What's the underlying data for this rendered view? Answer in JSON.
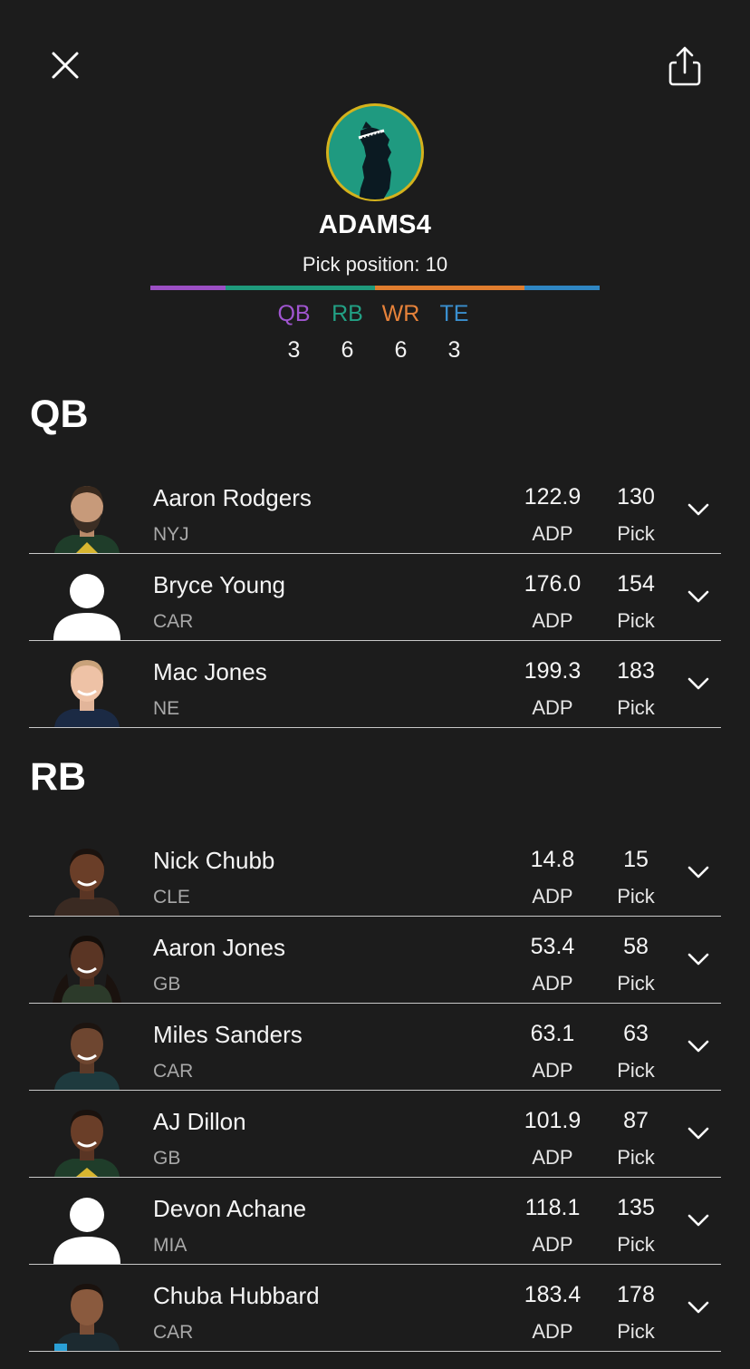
{
  "header": {
    "username": "ADAMS4",
    "pick_position": "Pick position: 10",
    "bar_colors": [
      "#9b4fc4",
      "#1f9a7c",
      "#e07d2e",
      "#2f86c2"
    ],
    "bar_fractions": [
      0.167,
      0.333,
      0.333,
      0.167
    ]
  },
  "counts": [
    {
      "label": "QB",
      "value": "3",
      "color": "#a055d0"
    },
    {
      "label": "RB",
      "value": "6",
      "color": "#22a084"
    },
    {
      "label": "WR",
      "value": "6",
      "color": "#e6823a"
    },
    {
      "label": "TE",
      "value": "3",
      "color": "#3a8fcf"
    }
  ],
  "sections": [
    {
      "title": "QB",
      "players": [
        {
          "name": "Aaron Rodgers",
          "team": "NYJ",
          "adp": "122.9",
          "adp_label": "ADP",
          "pick": "130",
          "pick_label": "Pick",
          "photo": "player-photo"
        },
        {
          "name": "Bryce Young",
          "team": "CAR",
          "adp": "176.0",
          "adp_label": "ADP",
          "pick": "154",
          "pick_label": "Pick",
          "photo": "placeholder"
        },
        {
          "name": "Mac Jones",
          "team": "NE",
          "adp": "199.3",
          "adp_label": "ADP",
          "pick": "183",
          "pick_label": "Pick",
          "photo": "player-photo"
        }
      ]
    },
    {
      "title": "RB",
      "players": [
        {
          "name": "Nick Chubb",
          "team": "CLE",
          "adp": "14.8",
          "adp_label": "ADP",
          "pick": "15",
          "pick_label": "Pick",
          "photo": "player-photo"
        },
        {
          "name": "Aaron Jones",
          "team": "GB",
          "adp": "53.4",
          "adp_label": "ADP",
          "pick": "58",
          "pick_label": "Pick",
          "photo": "player-photo"
        },
        {
          "name": "Miles Sanders",
          "team": "CAR",
          "adp": "63.1",
          "adp_label": "ADP",
          "pick": "63",
          "pick_label": "Pick",
          "photo": "player-photo"
        },
        {
          "name": "AJ Dillon",
          "team": "GB",
          "adp": "101.9",
          "adp_label": "ADP",
          "pick": "87",
          "pick_label": "Pick",
          "photo": "player-photo"
        },
        {
          "name": "Devon Achane",
          "team": "MIA",
          "adp": "118.1",
          "adp_label": "ADP",
          "pick": "135",
          "pick_label": "Pick",
          "photo": "placeholder"
        },
        {
          "name": "Chuba Hubbard",
          "team": "CAR",
          "adp": "183.4",
          "adp_label": "ADP",
          "pick": "178",
          "pick_label": "Pick",
          "photo": "player-photo"
        }
      ]
    }
  ]
}
